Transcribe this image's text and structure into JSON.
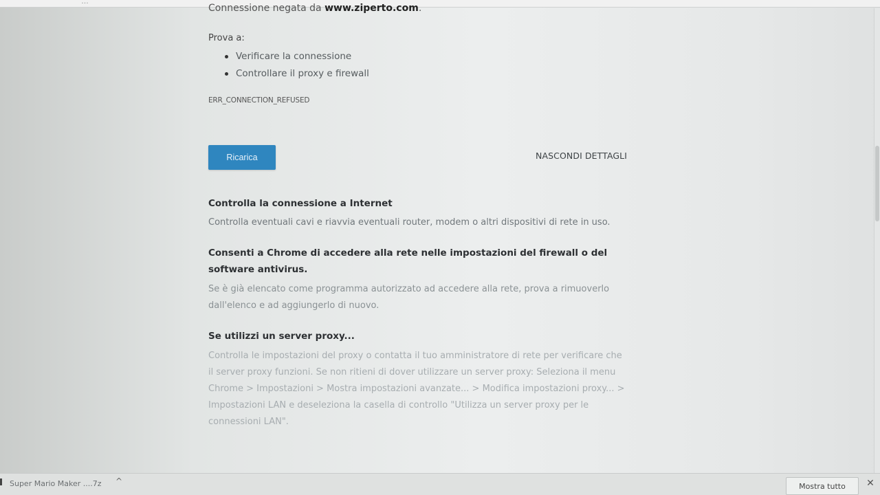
{
  "browser": {
    "tab_hint": "…"
  },
  "error_page": {
    "connection_refused_prefix": "Connessione negata da ",
    "connection_refused_host": "www.ziperto.com",
    "connection_refused_suffix": ".",
    "try_label": "Prova a:",
    "suggestions": [
      "Verificare la connessione",
      "Controllare il proxy e firewall"
    ],
    "error_code": "ERR_CONNECTION_REFUSED",
    "reload_label": "Ricarica",
    "details_label": "NASCONDI DETTAGLI",
    "sections": [
      {
        "title": "Controlla la connessione a Internet",
        "body": "Controlla eventuali cavi e riavvia eventuali router, modem o altri dispositivi di rete in uso."
      },
      {
        "title": "Consenti a Chrome di accedere alla rete nelle impostazioni del firewall o del software antivirus.",
        "body": "Se è già elencato come programma autorizzato ad accedere alla rete, prova a rimuoverlo dall'elenco e ad aggiungerlo di nuovo."
      },
      {
        "title": "Se utilizzi un server proxy...",
        "body": "Controlla le impostazioni del proxy o contatta il tuo amministratore di rete per verificare che il server proxy funzioni. Se non ritieni di dover utilizzare un server proxy: Seleziona il menu Chrome > Impostazioni > Mostra impostazioni avanzate... > Modifica impostazioni proxy... > Impostazioni LAN e deseleziona la casella di controllo \"Utilizza un server proxy per le connessioni LAN\"."
      }
    ]
  },
  "download_bar": {
    "item_label": "Super Mario Maker ....7z",
    "chevron": "^",
    "show_all_label": "Mostra tutto",
    "close_glyph": "✕"
  },
  "colors": {
    "reload_button": "#2f86bf",
    "background": "#e9ecec"
  }
}
